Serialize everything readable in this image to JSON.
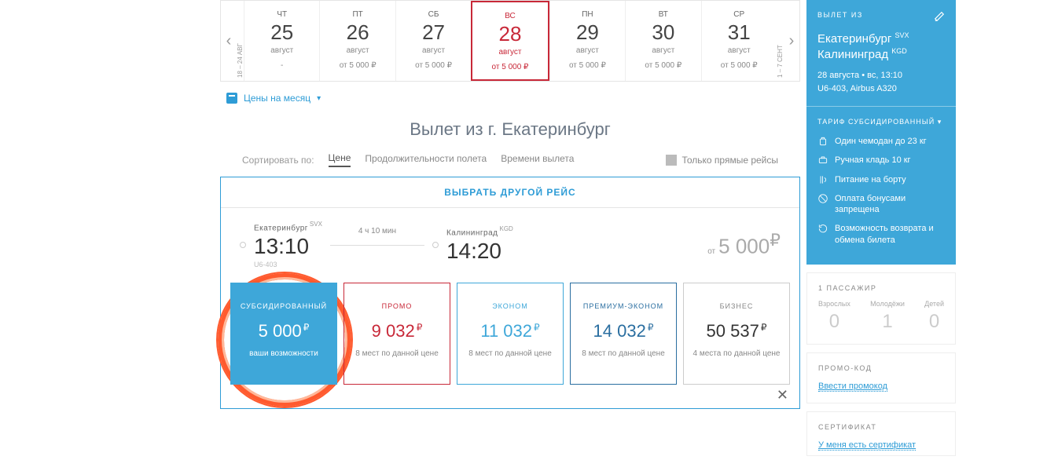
{
  "datebar": {
    "range_left": "18 – 24 АВГ",
    "range_right": "1 – 7 СЕНТ",
    "days": [
      {
        "dow": "ЧТ",
        "day": "25",
        "mon": "август",
        "price": "-"
      },
      {
        "dow": "ПТ",
        "day": "26",
        "mon": "август",
        "price": "от 5 000 ₽"
      },
      {
        "dow": "СБ",
        "day": "27",
        "mon": "август",
        "price": "от 5 000 ₽"
      },
      {
        "dow": "ВС",
        "day": "28",
        "mon": "август",
        "price": "от 5 000 ₽",
        "selected": true
      },
      {
        "dow": "ПН",
        "day": "29",
        "mon": "август",
        "price": "от 5 000 ₽"
      },
      {
        "dow": "ВТ",
        "day": "30",
        "mon": "август",
        "price": "от 5 000 ₽"
      },
      {
        "dow": "СР",
        "day": "31",
        "mon": "август",
        "price": "от 5 000 ₽"
      }
    ]
  },
  "month_prices_link": "Цены на месяц",
  "heading": "Вылет из г. Екатеринбург",
  "sort": {
    "label": "Сортировать по:",
    "price": "Цене",
    "duration": "Продолжительности полета",
    "time": "Времени вылета",
    "direct_only": "Только прямые рейсы"
  },
  "choose_other": "ВЫБРАТЬ ДРУГОЙ РЕЙС",
  "flight": {
    "from_city": "Екатеринбург",
    "from_code": "SVX",
    "from_time": "13:10",
    "flight_no": "U6-403",
    "duration": "4 ч 10 мин",
    "to_city": "Калининград",
    "to_code": "KGD",
    "to_time": "14:20",
    "from_label": "от",
    "from_price": "5 000",
    "currency": "₽"
  },
  "fares": [
    {
      "key": "sub",
      "name": "СУБСИДИРОВАННЫЙ",
      "price": "5 000",
      "note": "ваши возможности"
    },
    {
      "key": "promo",
      "name": "ПРОМО",
      "price": "9 032",
      "note": "8 мест по данной цене"
    },
    {
      "key": "econom",
      "name": "ЭКОНОМ",
      "price": "11 032",
      "note": "8 мест по данной цене"
    },
    {
      "key": "prem",
      "name": "ПРЕМИУМ-ЭКОНОМ",
      "price": "14 032",
      "note": "8 мест по данной цене"
    },
    {
      "key": "biz",
      "name": "БИЗНЕС",
      "price": "50 537",
      "note": "4 места по данной цене"
    }
  ],
  "sidebar": {
    "out_label": "ВЫЛЕТ ИЗ",
    "from_city": "Екатеринбург",
    "from_code": "SVX",
    "to_city": "Калининград",
    "to_code": "KGD",
    "meta1": "28 августа • вс, 13:10",
    "meta2": "U6-403, Airbus A320",
    "tariff_label": "ТАРИФ СУБСИДИРОВАННЫЙ ▾",
    "features": [
      "Один чемодан до 23 кг",
      "Ручная кладь 10 кг",
      "Питание на борту",
      "Оплата бонусами запрещена",
      "Возможность возврата и обмена билета"
    ],
    "pax_title": "1 ПАССАЖИР",
    "pax": [
      {
        "lbl": "Взрослых",
        "val": "0"
      },
      {
        "lbl": "Молодёжи",
        "val": "1"
      },
      {
        "lbl": "Детей",
        "val": "0"
      }
    ],
    "promo_title": "ПРОМО-КОД",
    "promo_link": "Ввести промокод",
    "cert_title": "СЕРТИФИКАТ",
    "cert_link": "У меня есть сертификат"
  }
}
